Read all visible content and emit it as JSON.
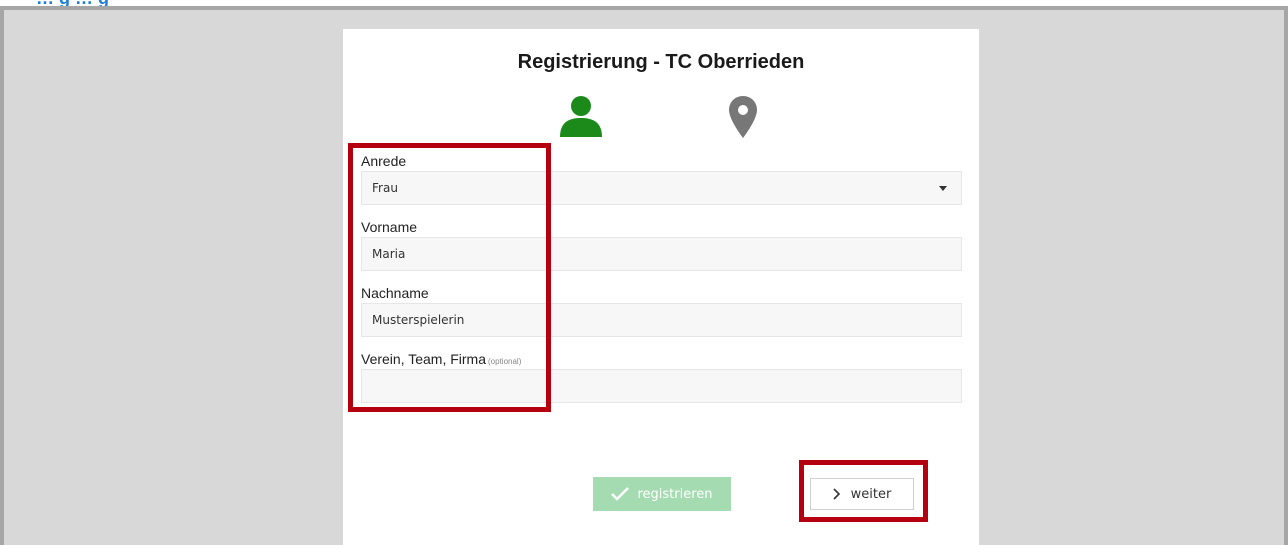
{
  "doc_heading": "… g … g",
  "form": {
    "title": "Registrierung - TC Oberrieden",
    "steps": [
      {
        "icon": "user-icon",
        "state": "active",
        "color": "#1b8a1b"
      },
      {
        "icon": "location-pin-icon",
        "state": "inactive",
        "color": "#777777"
      }
    ],
    "fields": [
      {
        "label": "Anrede",
        "optional": "",
        "value": "Frau",
        "type": "select"
      },
      {
        "label": "Vorname",
        "optional": "",
        "value": "Maria",
        "type": "text"
      },
      {
        "label": "Nachname",
        "optional": "",
        "value": "Musterspielerin",
        "type": "text"
      },
      {
        "label": "Verein, Team, Firma",
        "optional": "(optional)",
        "value": "",
        "type": "text"
      }
    ],
    "register_label": "registrieren",
    "next_label": "weiter"
  },
  "colors": {
    "accent_green": "#1b8a1b",
    "register_disabled": "#a4dbb1",
    "highlight_red": "#b4000f",
    "frame_bg": "#d8d8d8"
  }
}
